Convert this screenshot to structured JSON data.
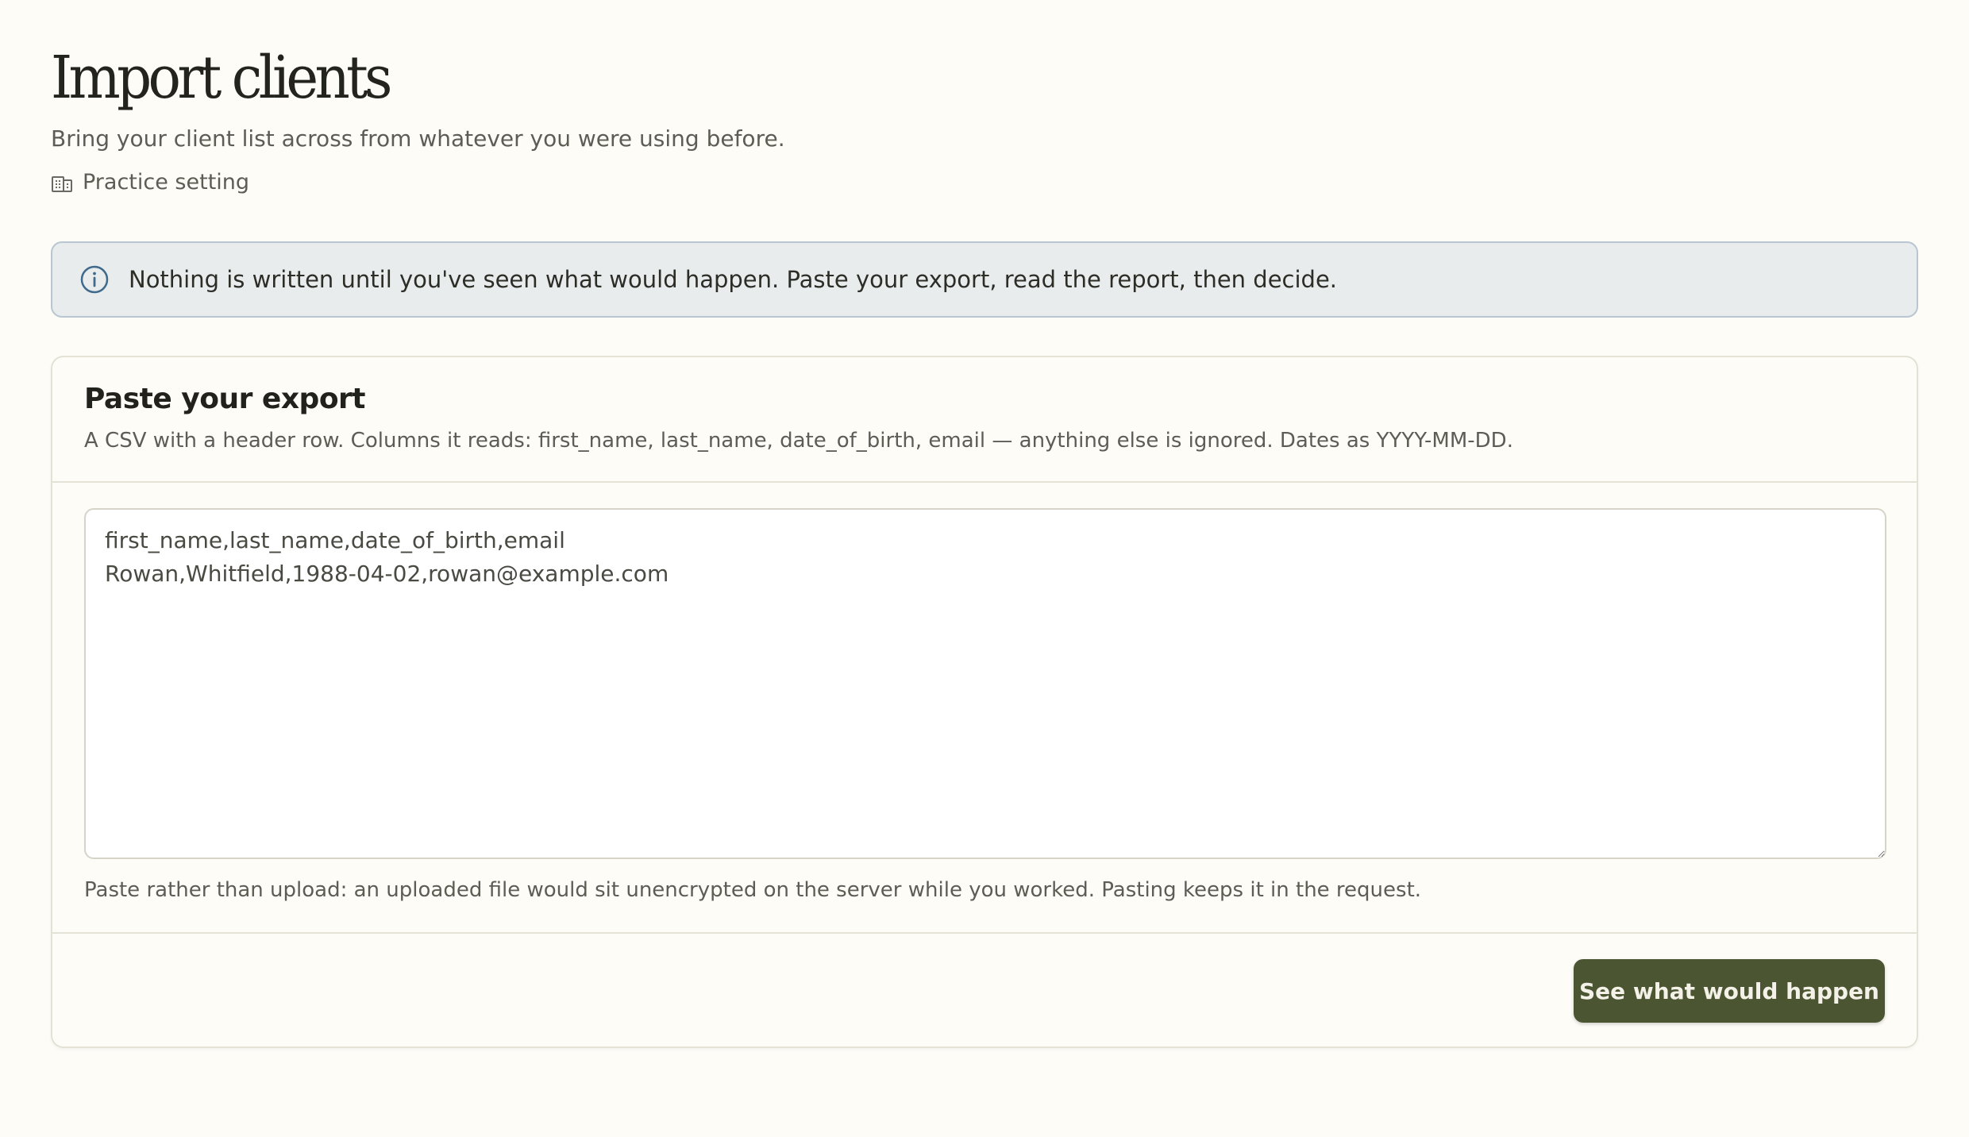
{
  "header": {
    "title": "Import clients",
    "subtitle": "Bring your client list across from whatever you were using before.",
    "setting_icon": "building-icon",
    "setting_label": "Practice setting"
  },
  "banner": {
    "icon": "info-icon",
    "text": "Nothing is written until you've seen what would happen. Paste your export, read the report, then decide."
  },
  "card": {
    "title": "Paste your export",
    "description": "A CSV with a header row. Columns it reads: first_name, last_name, date_of_birth, email — anything else is ignored. Dates as YYYY-MM-DD.",
    "textarea_value": "first_name,last_name,date_of_birth,email\nRowan,Whitfield,1988-04-02,rowan@example.com",
    "helper": "Paste rather than upload: an uploaded file would sit unencrypted on the server while you worked. Pasting keeps it in the request.",
    "submit_label": "See what would happen"
  },
  "colors": {
    "background": "#fdfcf7",
    "banner_bg": "#e8ecec",
    "banner_border": "#b9c5d0",
    "info_icon": "#3f6a8c",
    "primary_button": "#4b5531"
  }
}
